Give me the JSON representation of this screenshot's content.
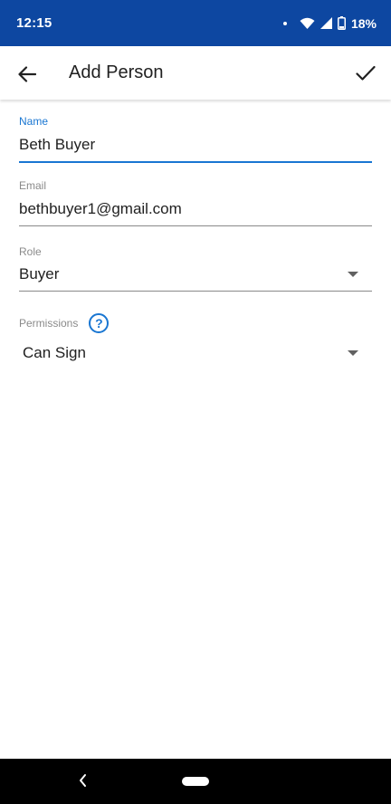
{
  "status_bar": {
    "time": "12:15",
    "battery": "18%",
    "background": "#0d47a1"
  },
  "app_bar": {
    "title": "Add Person",
    "back_icon": "arrow-left-icon",
    "confirm_icon": "check-icon"
  },
  "form": {
    "name": {
      "label": "Name",
      "value": "Beth Buyer"
    },
    "email": {
      "label": "Email",
      "value": "bethbuyer1@gmail.com"
    },
    "role": {
      "label": "Role",
      "value": "Buyer"
    },
    "permissions": {
      "label": "Permissions",
      "value": "Can Sign",
      "help_icon": "?"
    }
  },
  "colors": {
    "accent": "#1976d2",
    "nav_bar": "#000000"
  }
}
